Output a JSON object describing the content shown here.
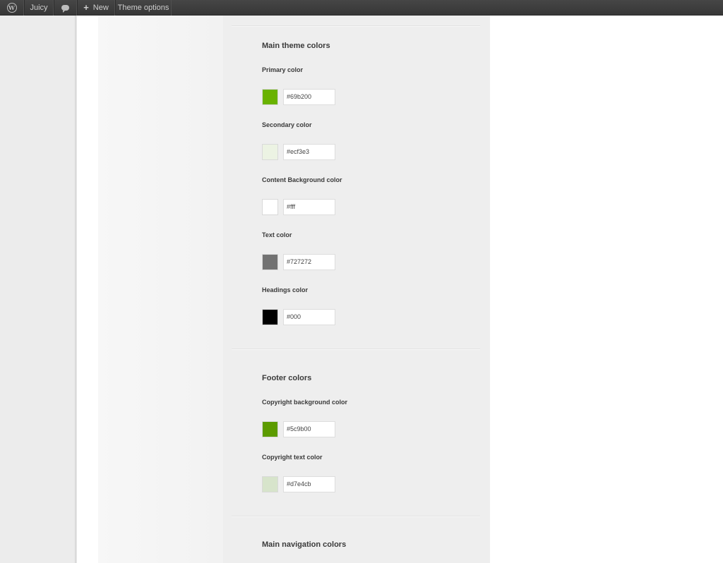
{
  "admin_bar": {
    "site_name": "Juicy",
    "new_label": "New",
    "theme_options_label": "Theme options",
    "icons": {
      "logo": "wordpress-logo-icon",
      "comments": "comment-bubble-icon",
      "new": "plus-icon"
    }
  },
  "sections": {
    "main": {
      "title": "Main theme colors",
      "fields": [
        {
          "label": "Primary color",
          "value": "#69b200",
          "swatch": "#69b200"
        },
        {
          "label": "Secondary color",
          "value": "#ecf3e3",
          "swatch": "#ecf3e3"
        },
        {
          "label": "Content Background color",
          "value": "#fff",
          "swatch": "#ffffff"
        },
        {
          "label": "Text color",
          "value": "#727272",
          "swatch": "#727272"
        },
        {
          "label": "Headings color",
          "value": "#000",
          "swatch": "#000000"
        }
      ]
    },
    "footer": {
      "title": "Footer colors",
      "fields": [
        {
          "label": "Copyright background color",
          "value": "#5c9b00",
          "swatch": "#5c9b00"
        },
        {
          "label": "Copyright text color",
          "value": "#d7e4cb",
          "swatch": "#d7e4cb"
        }
      ]
    },
    "nav": {
      "title": "Main navigation colors"
    }
  }
}
